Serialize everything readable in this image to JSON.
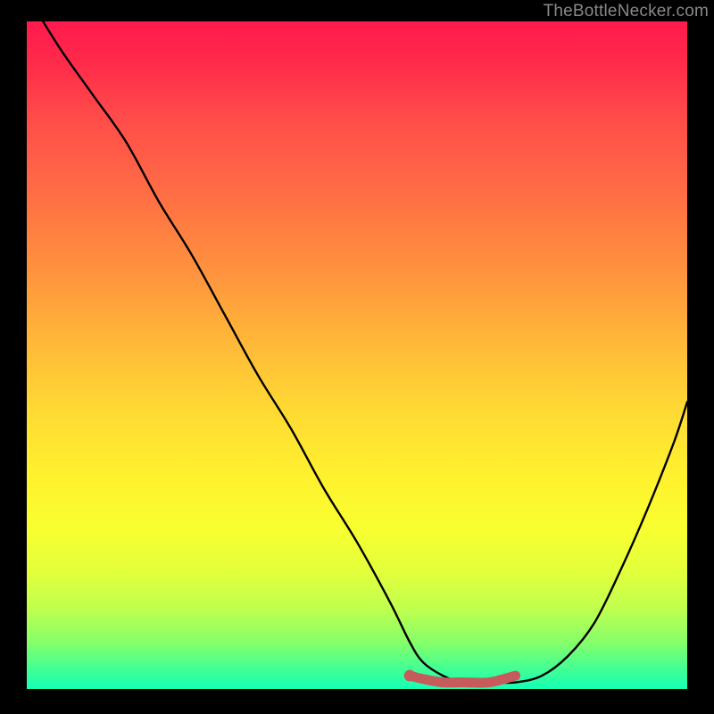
{
  "watermark": "TheBottleNecker.com",
  "chart_data": {
    "type": "line",
    "title": "",
    "xlabel": "",
    "ylabel": "",
    "xlim": [
      0,
      100
    ],
    "ylim": [
      0,
      100
    ],
    "grid": false,
    "legend": false,
    "series": [
      {
        "name": "bottleneck-curve",
        "color": "#000000",
        "x": [
          0,
          5,
          10,
          15,
          20,
          25,
          30,
          35,
          40,
          45,
          50,
          55,
          58,
          60,
          63,
          66,
          70,
          74,
          78,
          82,
          86,
          90,
          94,
          98,
          100
        ],
        "values": [
          104,
          96,
          89,
          82,
          73,
          65,
          56,
          47,
          39,
          30,
          22,
          13,
          7,
          4,
          2,
          1,
          1,
          1,
          2,
          5,
          10,
          18,
          27,
          37,
          43
        ]
      },
      {
        "name": "highlight-band",
        "color": "#c75a5a",
        "x": [
          58,
          60,
          63,
          66,
          70,
          74
        ],
        "values": [
          2,
          1.5,
          1,
          1,
          1,
          2
        ]
      }
    ],
    "gradient_stops": [
      {
        "pos": 0,
        "color": "#ff1a4d"
      },
      {
        "pos": 14,
        "color": "#ff4a4a"
      },
      {
        "pos": 38,
        "color": "#ff943e"
      },
      {
        "pos": 58,
        "color": "#ffd934"
      },
      {
        "pos": 76,
        "color": "#f8ff30"
      },
      {
        "pos": 93,
        "color": "#86ff69"
      },
      {
        "pos": 100,
        "color": "#15ffb8"
      }
    ]
  }
}
